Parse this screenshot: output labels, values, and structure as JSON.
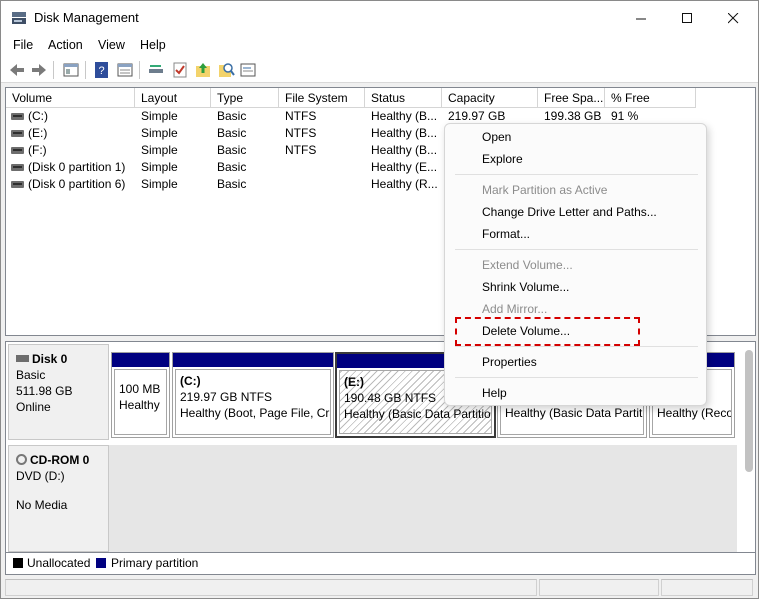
{
  "window": {
    "title": "Disk Management",
    "buttons": [
      "—",
      "☐",
      "✕"
    ]
  },
  "menu": [
    "File",
    "Action",
    "View",
    "Help"
  ],
  "toolbar": {
    "icons": [
      "back-arrow-icon",
      "forward-arrow-icon",
      "console-tree-icon",
      "help-icon",
      "properties-icon",
      "refresh-icon",
      "check-icon",
      "up-folder-icon",
      "search-icon",
      "settings-icon"
    ]
  },
  "volume_list": {
    "columns": [
      "Volume",
      "Layout",
      "Type",
      "File System",
      "Status",
      "Capacity",
      "Free Spa...",
      "% Free"
    ],
    "rows": [
      {
        "volume": "(C:)",
        "layout": "Simple",
        "type": "Basic",
        "fs": "NTFS",
        "status": "Healthy (B...",
        "capacity": "219.97 GB",
        "free": "199.38 GB",
        "pct": "91 %"
      },
      {
        "volume": "(E:)",
        "layout": "Simple",
        "type": "Basic",
        "fs": "NTFS",
        "status": "Healthy (B...",
        "capacity": "",
        "free": "",
        "pct": ""
      },
      {
        "volume": "(F:)",
        "layout": "Simple",
        "type": "Basic",
        "fs": "NTFS",
        "status": "Healthy (B...",
        "capacity": "",
        "free": "",
        "pct": ""
      },
      {
        "volume": "(Disk 0 partition 1)",
        "layout": "Simple",
        "type": "Basic",
        "fs": "",
        "status": "Healthy (E...",
        "capacity": "",
        "free": "",
        "pct": ""
      },
      {
        "volume": "(Disk 0 partition 6)",
        "layout": "Simple",
        "type": "Basic",
        "fs": "",
        "status": "Healthy (R...",
        "capacity": "",
        "free": "",
        "pct": ""
      }
    ]
  },
  "disk0": {
    "name": "Disk 0",
    "type": "Basic",
    "size": "511.98 GB",
    "state": "Online",
    "partitions": [
      {
        "line1": "100 MB",
        "line2": "Healthy"
      },
      {
        "line0": "(C:)",
        "line1": "219.97 GB NTFS",
        "line2": "Healthy (Boot, Page File, Cra"
      },
      {
        "line0": "(E:)",
        "line1": "190.48 GB NTFS",
        "line2": "Healthy (Basic Data Partition"
      },
      {
        "line2": "Healthy (Basic Data Partiti"
      },
      {
        "line2": "Healthy (Reco"
      }
    ]
  },
  "cdrom": {
    "name": "CD-ROM 0",
    "type": "DVD (D:)",
    "state": "No Media"
  },
  "legend": {
    "unallocated": "Unallocated",
    "primary": "Primary partition",
    "unallocated_color": "#000000",
    "primary_color": "#000080"
  },
  "context_menu": {
    "items": {
      "open": "Open",
      "explore": "Explore",
      "mark_active": "Mark Partition as Active",
      "change_letter": "Change Drive Letter and Paths...",
      "format": "Format...",
      "extend": "Extend Volume...",
      "shrink": "Shrink Volume...",
      "add_mirror": "Add Mirror...",
      "delete": "Delete Volume...",
      "properties": "Properties",
      "help": "Help"
    },
    "highlight_color": "#d40000"
  }
}
